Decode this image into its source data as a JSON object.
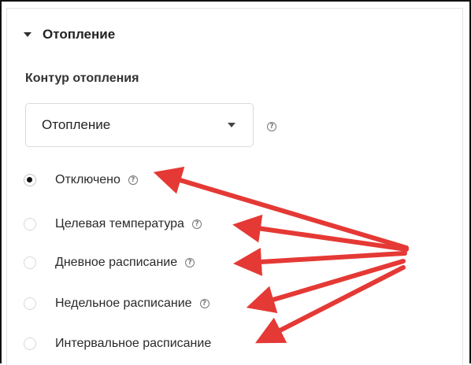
{
  "section": {
    "title": "Отопление",
    "caret_icon": "caret-down-icon"
  },
  "heating_circuit": {
    "label": "Контур отопления",
    "selected": "Отопление",
    "help_icon": "question-circle-icon"
  },
  "modes": [
    {
      "label": "Отключено",
      "checked": true,
      "has_help": true
    },
    {
      "label": "Целевая температура",
      "checked": false,
      "has_help": true
    },
    {
      "label": "Дневное расписание",
      "checked": false,
      "has_help": true
    },
    {
      "label": "Недельное расписание",
      "checked": false,
      "has_help": true
    },
    {
      "label": "Интервальное расписание",
      "checked": false,
      "has_help": false
    }
  ],
  "annotation": {
    "arrow_color": "#e53935",
    "arrow_count": 5
  },
  "help_glyph": "?"
}
